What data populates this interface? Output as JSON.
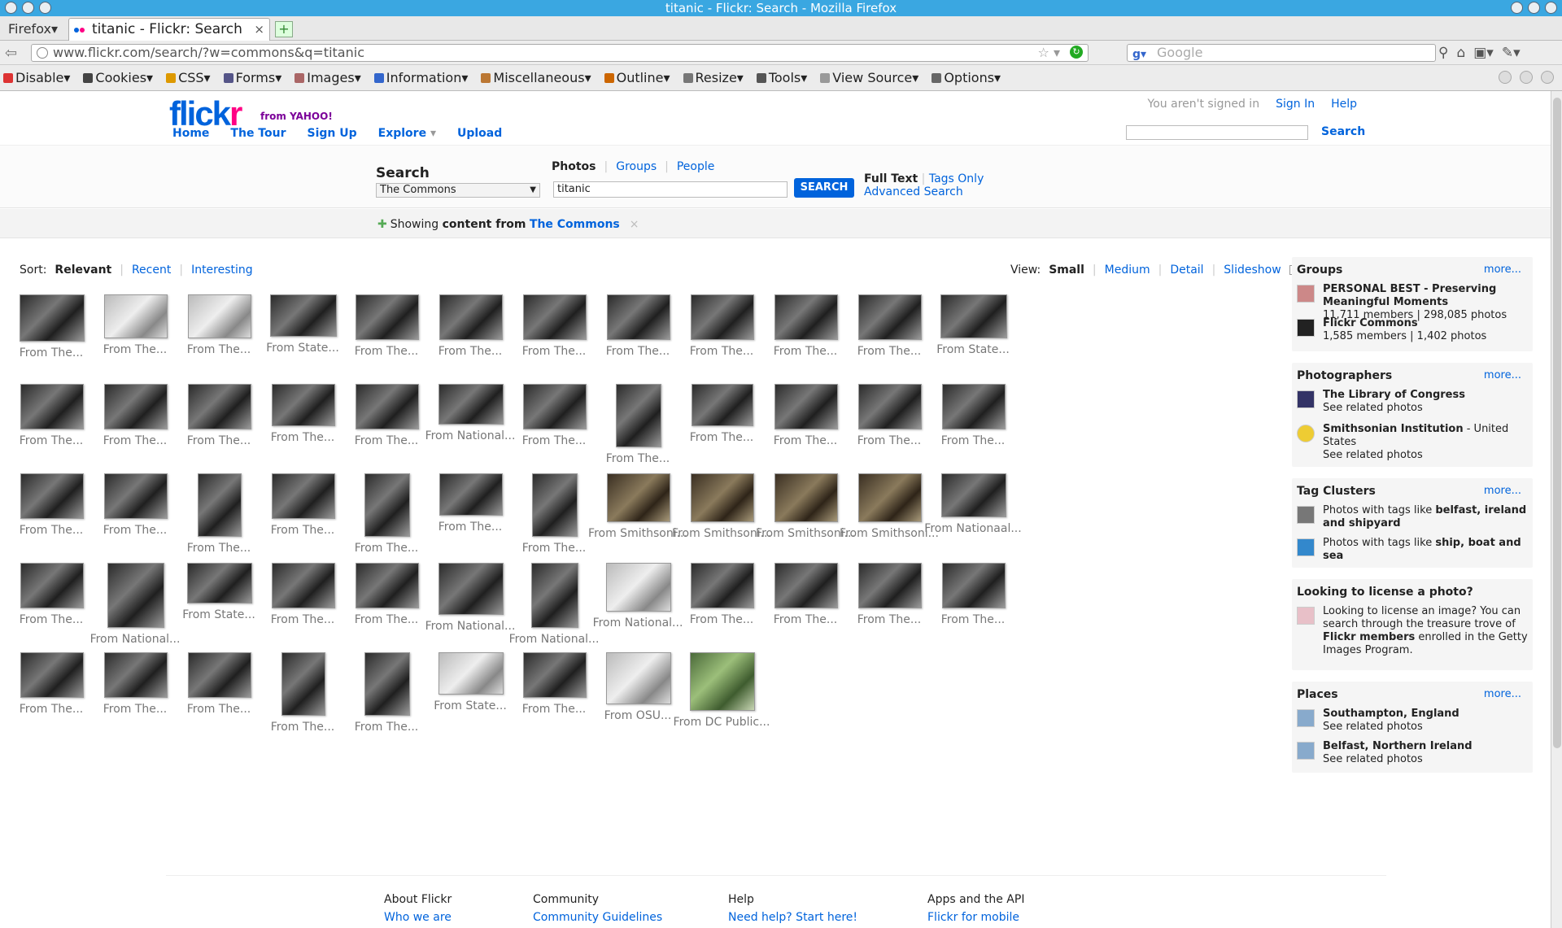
{
  "window": {
    "title": "titanic - Flickr: Search - Mozilla Firefox"
  },
  "tabs": {
    "menu_label": "Firefox",
    "active_tab": "titanic - Flickr: Search"
  },
  "nav": {
    "url": "www.flickr.com/search/?w=commons&q=titanic",
    "search_placeholder": "Google"
  },
  "webdev": [
    "Disable",
    "Cookies",
    "CSS",
    "Forms",
    "Images",
    "Information",
    "Miscellaneous",
    "Outline",
    "Resize",
    "Tools",
    "View Source",
    "Options"
  ],
  "header": {
    "logo_part1": "flick",
    "logo_part2": "r",
    "logo_yahoo": "from YAHOO!",
    "nav": [
      "Home",
      "The Tour",
      "Sign Up",
      "Explore",
      "Upload"
    ],
    "explore_arrow": "▾",
    "signed_in_note": "You aren't signed in",
    "sign_in": "Sign In",
    "help": "Help",
    "search_btn": "Search"
  },
  "search": {
    "title": "Search",
    "scope": "The Commons",
    "tabs": [
      "Photos",
      "Groups",
      "People"
    ],
    "query": "titanic",
    "button": "SEARCH",
    "full_text": "Full Text",
    "tags_only": "Tags Only",
    "advanced": "Advanced Search"
  },
  "showing": {
    "prefix": "Showing",
    "bold": "content from",
    "link": "The Commons",
    "close": "×"
  },
  "sort": {
    "label": "Sort:",
    "options": [
      "Relevant",
      "Recent",
      "Interesting"
    ]
  },
  "view": {
    "label": "View:",
    "options": [
      "Small",
      "Medium",
      "Detail",
      "Slideshow"
    ]
  },
  "photos": [
    [
      "From The...",
      "From The...",
      "From The...",
      "From State...",
      "From The...",
      "From The...",
      "From The...",
      "From The...",
      "From The...",
      "From The...",
      "From The...",
      "From State..."
    ],
    [
      "From The...",
      "From The...",
      "From The...",
      "From The...",
      "From The...",
      "From National...",
      "From The...",
      "From The...",
      "From The...",
      "From The...",
      "From The...",
      "From The..."
    ],
    [
      "From The...",
      "From The...",
      "From The...",
      "From The...",
      "From The...",
      "From The...",
      "From The...",
      "From Smithsoni...",
      "From Smithsoni...",
      "From Smithsoni...",
      "From Smithsoni...",
      "From Nationaal..."
    ],
    [
      "From The...",
      "From National...",
      "From State...",
      "From The...",
      "From The...",
      "From National...",
      "From National...",
      "From National...",
      "From The...",
      "From The...",
      "From The...",
      "From The..."
    ],
    [
      "From The...",
      "From The...",
      "From The...",
      "From The...",
      "From The...",
      "From State...",
      "From The...",
      "From OSU...",
      "From DC Public..."
    ]
  ],
  "sidebar": {
    "groups": {
      "title": "Groups",
      "more": "more...",
      "items": [
        {
          "name": "PERSONAL BEST - Preserving Meaningful Moments",
          "stats": "11,711 members | 298,085 photos"
        },
        {
          "name": "Flickr Commons",
          "stats": "1,585 members | 1,402 photos"
        }
      ]
    },
    "photographers": {
      "title": "Photographers",
      "more": "more...",
      "items": [
        {
          "name": "The Library of Congress",
          "extra": "",
          "sub": "See related photos"
        },
        {
          "name": "Smithsonian Institution",
          "extra": " - United States",
          "sub": "See related photos"
        }
      ]
    },
    "tags": {
      "title": "Tag Clusters",
      "more": "more...",
      "items": [
        {
          "prefix": "Photos with tags like ",
          "tags": "belfast, ireland and shipyard"
        },
        {
          "prefix": "Photos with tags like ",
          "tags": "ship, boat and sea"
        }
      ]
    },
    "license": {
      "title": "Looking to license a photo?",
      "text1": "Looking to license an image? You can search through the treasure trove of ",
      "bold": "Flickr members",
      "text2": " enrolled in the Getty Images Program."
    },
    "places": {
      "title": "Places",
      "more": "more...",
      "items": [
        {
          "name": "Southampton, England",
          "sub": "See related photos"
        },
        {
          "name": "Belfast, Northern Ireland",
          "sub": "See related photos"
        }
      ]
    }
  },
  "footer": [
    {
      "heading": "About Flickr",
      "link": "Who we are"
    },
    {
      "heading": "Community",
      "link": "Community Guidelines"
    },
    {
      "heading": "Help",
      "link": "Need help? Start here!"
    },
    {
      "heading": "Apps and the API",
      "link": "Flickr for mobile"
    }
  ]
}
